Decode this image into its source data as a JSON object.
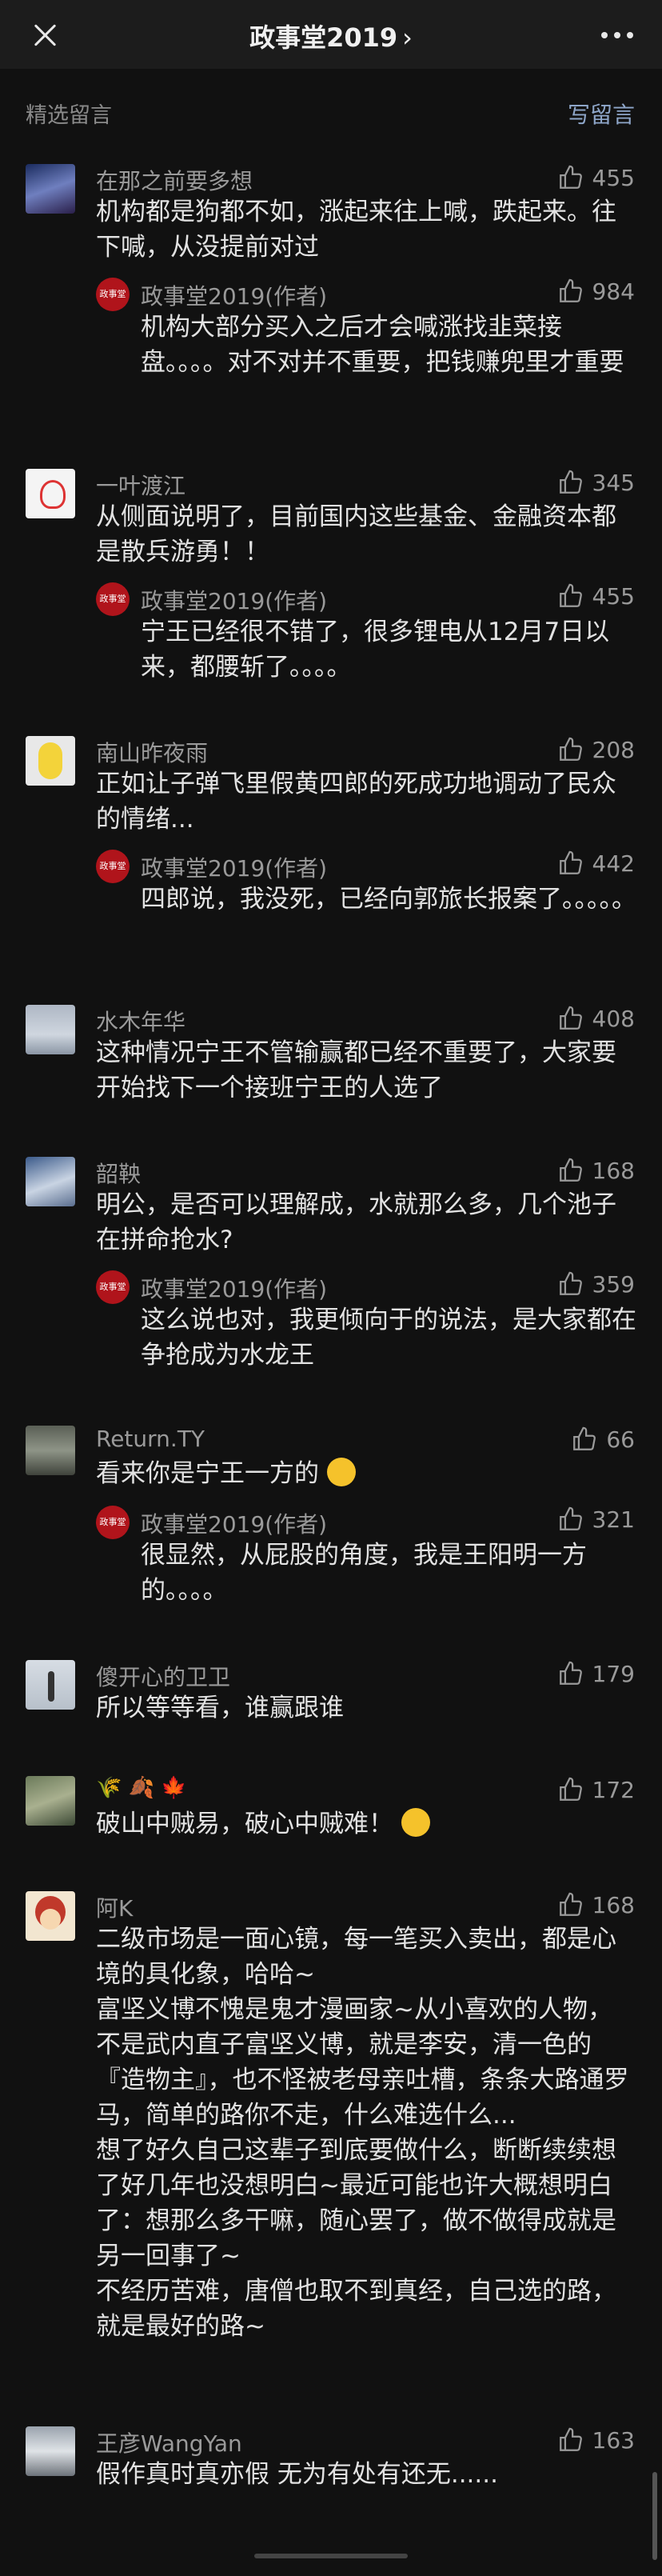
{
  "header": {
    "title": "政事堂2019",
    "chevron": "›"
  },
  "section": {
    "label": "精选留言",
    "write_label": "写留言"
  },
  "comments": [
    {
      "author": "在那之前要多想",
      "likes": "455",
      "body": "机构都是狗都不如，涨起来往上喊，跌起来。往下喊，从没提前对过",
      "reply": {
        "author": "政事堂2019(作者)",
        "likes": "984",
        "body": "机构大部分买入之后才会喊涨找韭菜接盘。。。。对不对并不重要，把钱赚兜里才重要"
      }
    },
    {
      "author": "一叶渡江",
      "likes": "345",
      "body": "从侧面说明了，目前国内这些基金、金融资本都是散兵游勇！！",
      "reply": {
        "author": "政事堂2019(作者)",
        "likes": "455",
        "body": "宁王已经很不错了，很多锂电从12月7日以来，都腰斩了。。。。"
      }
    },
    {
      "author": "南山昨夜雨",
      "likes": "208",
      "body": "正如让子弹飞里假黄四郎的死成功地调动了民众的情绪...",
      "reply": {
        "author": "政事堂2019(作者)",
        "likes": "442",
        "body": "四郎说，我没死，已经向郭旅长报案了。。。。。"
      }
    },
    {
      "author": "水木年华",
      "likes": "408",
      "body": "这种情况宁王不管输赢都已经不重要了，大家要开始找下一个接班宁王的人选了"
    },
    {
      "author": "韶鞅",
      "likes": "168",
      "body": "明公，是否可以理解成，水就那么多，几个池子在拼命抢水?",
      "reply": {
        "author": "政事堂2019(作者)",
        "likes": "359",
        "body": "这么说也对，我更倾向于的说法，是大家都在争抢成为水龙王"
      }
    },
    {
      "author": "Return.TY",
      "likes": "66",
      "body": "看来你是宁王一方的",
      "reply": {
        "author": "政事堂2019(作者)",
        "likes": "321",
        "body": "很显然，从屁股的角度，我是王阳明一方的。。。。"
      }
    },
    {
      "author": "傻开心的卫卫",
      "likes": "179",
      "body": "所以等等看，谁赢跟谁"
    },
    {
      "author": "",
      "likes": "172",
      "body": "破山中贼易，破心中贼难！"
    },
    {
      "author": "阿K",
      "likes": "168",
      "body": "二级市场是一面心镜，每一笔买入卖出，都是心境的具化象，哈哈~\n富坚义博不愧是鬼才漫画家~从小喜欢的人物，不是武内直子富坚义博，就是李安，清一色的『造物主』，也不怪被老母亲吐槽，条条大路通罗马，简单的路你不走，什么难选什么...\n想了好久自己这辈子到底要做什么，断断续续想了好几年也没想明白~最近可能也许大概想明白了：想那么多干嘛，随心罢了，做不做得成就是另一回事了~\n不经历苦难，唐僧也取不到真经，自己选的路，就是最好的路~"
    },
    {
      "author": "王彦WangYan",
      "likes": "163",
      "body": "假作真时真亦假 无为有处有还无......"
    }
  ],
  "icons": {
    "like": "thumbs-up-icon",
    "close": "close-icon",
    "more": "more-icon"
  },
  "colors": {
    "background": "#111111",
    "header_bg": "#1c1c1c",
    "link": "#8ea6c9",
    "meta": "#9a9a9a",
    "text": "#e2e2e2",
    "author_badge": "#b0141b"
  }
}
